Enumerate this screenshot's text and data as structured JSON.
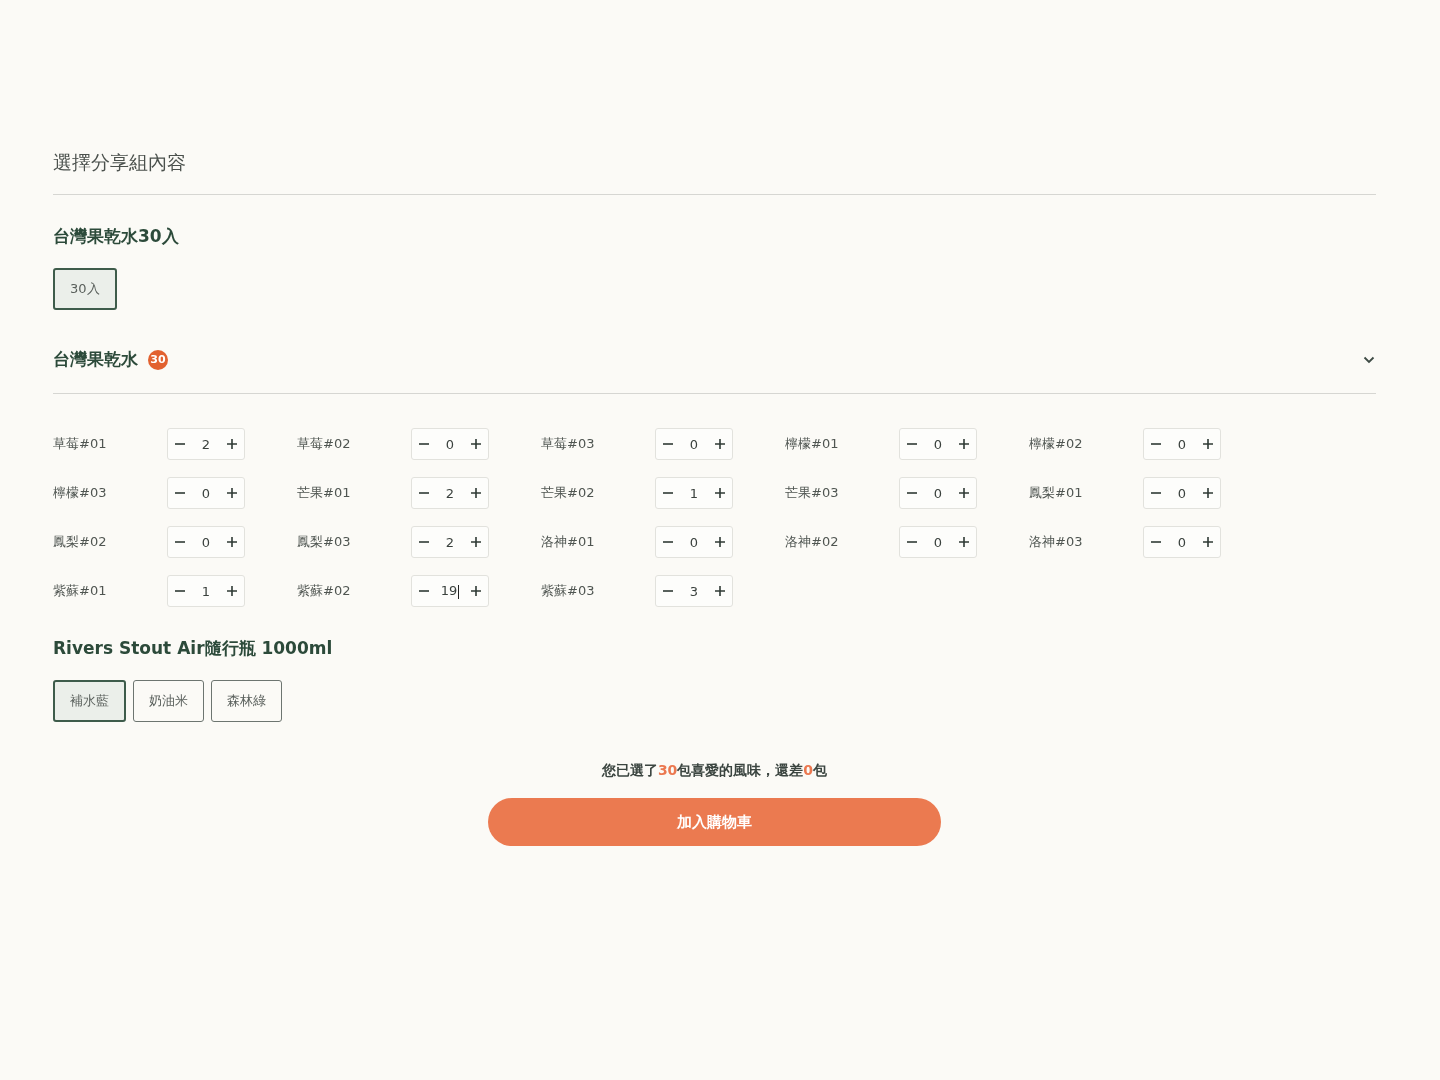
{
  "page_title": "選擇分享組內容",
  "bundle": {
    "title": "台灣果乾水30入",
    "options": [
      {
        "label": "30入",
        "selected": true
      }
    ]
  },
  "flavors": {
    "title": "台灣果乾水",
    "badge": "30",
    "expanded": true,
    "items": [
      {
        "name": "草莓#01",
        "quantity": "2",
        "focused": false
      },
      {
        "name": "草莓#02",
        "quantity": "0",
        "focused": false
      },
      {
        "name": "草莓#03",
        "quantity": "0",
        "focused": false
      },
      {
        "name": "檸檬#01",
        "quantity": "0",
        "focused": false
      },
      {
        "name": "檸檬#02",
        "quantity": "0",
        "focused": false
      },
      {
        "name": "檸檬#03",
        "quantity": "0",
        "focused": false
      },
      {
        "name": "芒果#01",
        "quantity": "2",
        "focused": false
      },
      {
        "name": "芒果#02",
        "quantity": "1",
        "focused": false
      },
      {
        "name": "芒果#03",
        "quantity": "0",
        "focused": false
      },
      {
        "name": "鳳梨#01",
        "quantity": "0",
        "focused": false
      },
      {
        "name": "鳳梨#02",
        "quantity": "0",
        "focused": false
      },
      {
        "name": "鳳梨#03",
        "quantity": "2",
        "focused": false
      },
      {
        "name": "洛神#01",
        "quantity": "0",
        "focused": false
      },
      {
        "name": "洛神#02",
        "quantity": "0",
        "focused": false
      },
      {
        "name": "洛神#03",
        "quantity": "0",
        "focused": false
      },
      {
        "name": "紫蘇#01",
        "quantity": "1",
        "focused": false
      },
      {
        "name": "紫蘇#02",
        "quantity": "19",
        "focused": true
      },
      {
        "name": "紫蘇#03",
        "quantity": "3",
        "focused": false
      }
    ]
  },
  "bottle": {
    "title": "Rivers Stout Air隨行瓶 1000ml",
    "options": [
      {
        "label": "補水藍",
        "selected": true
      },
      {
        "label": "奶油米",
        "selected": false
      },
      {
        "label": "森林綠",
        "selected": false
      }
    ]
  },
  "summary": {
    "before": "您已選了",
    "selected_count": "30",
    "middle": "包喜愛的風味，還差",
    "remaining_count": "0",
    "after": "包"
  },
  "add_to_cart": "加入購物車"
}
